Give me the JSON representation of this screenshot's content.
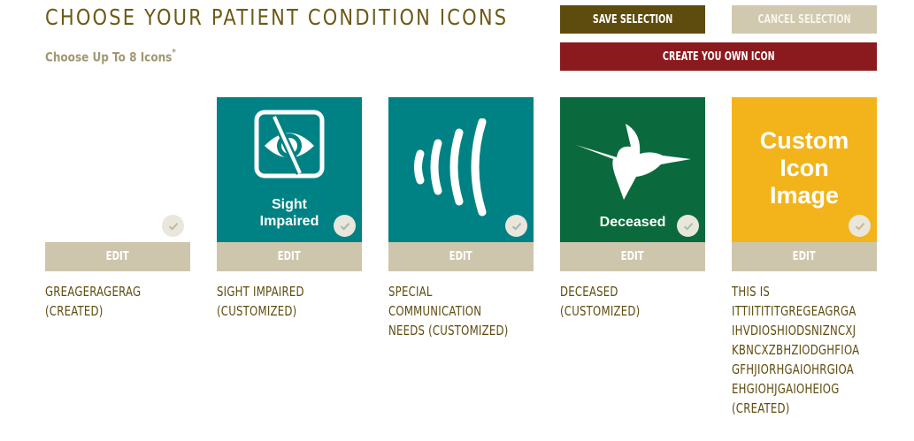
{
  "header": {
    "title": "CHOOSE YOUR PATIENT CONDITION ICONS",
    "subtitle": "Choose Up To 8 Icons",
    "subtitle_mark": "*"
  },
  "actions": {
    "save_label": "SAVE SELECTION",
    "cancel_label": "CANCEL SELECTION",
    "create_label": "CREATE YOU OWN ICON"
  },
  "colors": {
    "title": "#6b5a16",
    "save_button": "#5e4c0e",
    "cancel_button": "#d0c9b0",
    "create_button": "#8b1a1e",
    "teal": "#008285",
    "green": "#0b6a3d",
    "gold": "#f2b41a",
    "edit_button": "#cdc6ac"
  },
  "cards": [
    {
      "caption": "GREAGERAGERAG\n(CREATED)",
      "edit_label": "EDIT",
      "icon": "blank",
      "tile_text": "",
      "selected": true
    },
    {
      "caption": "SIGHT IMPAIRED\n(CUSTOMIZED)",
      "edit_label": "EDIT",
      "icon": "eye-slash-icon",
      "tile_text": "Sight\nImpaired",
      "selected": true
    },
    {
      "caption": "SPECIAL\nCOMMUNICATION\nNEEDS (CUSTOMIZED)",
      "edit_label": "EDIT",
      "icon": "sound-waves-icon",
      "tile_text": "",
      "selected": true
    },
    {
      "caption": "DECEASED\n(CUSTOMIZED)",
      "edit_label": "EDIT",
      "icon": "hummingbird-icon",
      "tile_text": "Deceased",
      "selected": true
    },
    {
      "caption": "THIS IS\nITTIITITITGREGEAGRGA\nIHVDIOSHIODSNIZNCXJ\nKBNCXZBHZIODGHFIOA\nGFHJIORHGAIOHRGIOA\nEHGIOHJGAIOHEIOG\n(CREATED)",
      "edit_label": "EDIT",
      "icon": "custom-image",
      "tile_text": "Custom\nIcon\nImage",
      "selected": true
    }
  ]
}
